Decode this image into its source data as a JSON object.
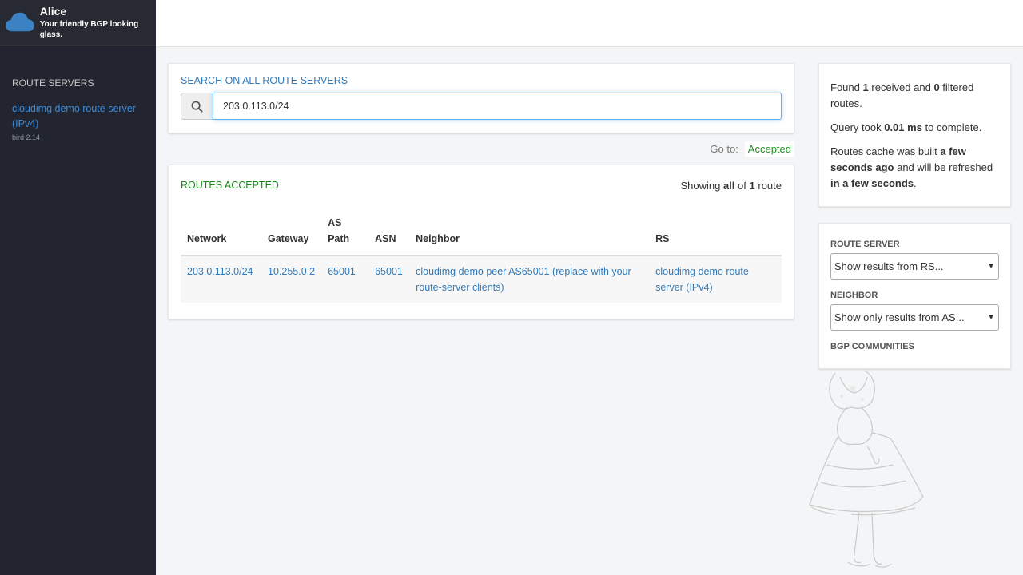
{
  "brand": {
    "title": "Alice",
    "tagline": "Your friendly BGP looking glass."
  },
  "sidebar": {
    "heading": "ROUTE SERVERS",
    "route_servers": [
      {
        "name": "cloudimg demo route server (IPv4)",
        "version": "bird 2.14"
      }
    ]
  },
  "search": {
    "title": "SEARCH ON ALL ROUTE SERVERS",
    "query": "203.0.113.0/24",
    "icon": "search-icon"
  },
  "goto": {
    "label": "Go to:",
    "link": "Accepted"
  },
  "routes": {
    "title": "ROUTES ACCEPTED",
    "count": {
      "prefix": "Showing",
      "all": "all",
      "of": "of",
      "total": "1",
      "unit": "route"
    },
    "columns": [
      "Network",
      "Gateway",
      "AS Path",
      "ASN",
      "Neighbor",
      "RS"
    ],
    "rows": [
      {
        "network": "203.0.113.0/24",
        "gateway": "10.255.0.2",
        "as_path": "65001",
        "asn": "65001",
        "neighbor": "cloudimg demo peer AS65001 (replace with your route-server clients)",
        "rs": "cloudimg demo route server (IPv4)"
      }
    ]
  },
  "stats": {
    "found_prefix": "Found",
    "received": "1",
    "received_mid": "received and",
    "filtered": "0",
    "filtered_suffix": "filtered routes.",
    "query_prefix": "Query took",
    "query_time": "0.01 ms",
    "query_suffix": "to complete.",
    "cache_prefix": "Routes cache was built",
    "cache_built": "a few seconds ago",
    "cache_mid": "and will be refreshed",
    "cache_refresh": "in a few seconds",
    "cache_end": "."
  },
  "filters": {
    "route_server_label": "ROUTE SERVER",
    "route_server_value": "Show results from RS...",
    "neighbor_label": "NEIGHBOR",
    "neighbor_value": "Show only results from AS...",
    "communities_label": "BGP COMMUNITIES"
  },
  "colors": {
    "sidebar": "#222530",
    "link": "#337ab7",
    "accepted": "#1a8a1a"
  }
}
